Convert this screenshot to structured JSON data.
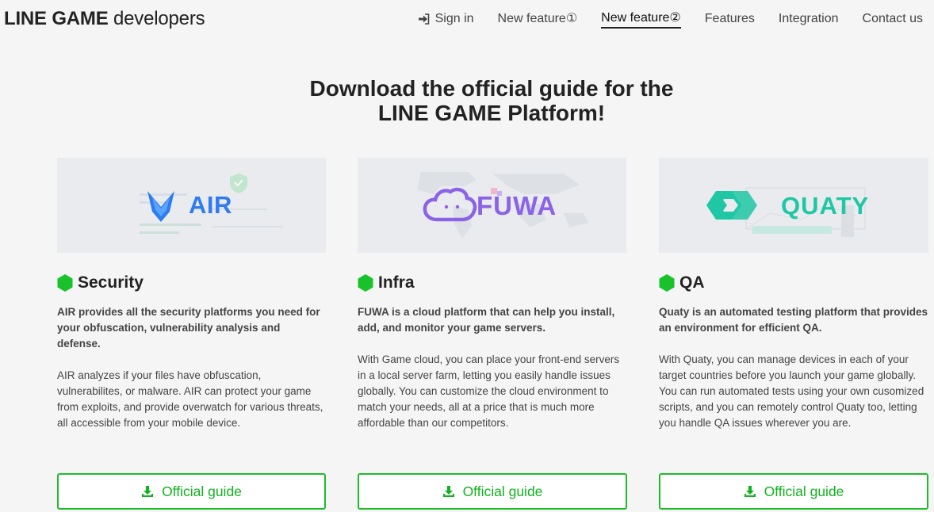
{
  "header": {
    "brand_bold": "LINE GAME",
    "brand_rest": " developers",
    "nav": [
      {
        "label": "Sign in",
        "icon": "sign-in-icon"
      },
      {
        "label": "New feature①"
      },
      {
        "label": "New feature②",
        "active": true
      },
      {
        "label": "Features"
      },
      {
        "label": "Integration"
      },
      {
        "label": "Contact us"
      }
    ]
  },
  "hero": {
    "line1": "Download the official guide for the",
    "line2": "LINE GAME Platform!"
  },
  "columns": [
    {
      "logo_text": "AIR",
      "title": "Security",
      "lead": "AIR provides all the security platforms you need for your obfuscation, vulnerability analysis and defense.",
      "body": "AIR analyzes if your files have obfuscation, vulnerabilites, or malware. AIR can protect your game from exploits, and provide overwatch for various threats, all accessible from your mobile device.",
      "button": "Official guide"
    },
    {
      "logo_text": "FUWA",
      "title": "Infra",
      "lead": "FUWA is a cloud platform that can help you install, add, and monitor your game servers.",
      "body": "With Game cloud, you can place your front-end servers in a local server farm, letting you easily handle issues globally. You can customize the cloud environment to match your needs, all at a price that is much more affordable than our competitors.",
      "button": "Official guide"
    },
    {
      "logo_text": "QUATY",
      "title": "QA",
      "lead": "Quaty is an automated testing platform that provides an environment for efficient QA.",
      "body": "With Quaty, you can manage devices in each of your target countries before you launch your game globally. You can run automated tests using your own cusomized scripts, and you can remotely control Quaty too, letting you handle QA issues wherever you are.",
      "button": "Official guide"
    }
  ],
  "colors": {
    "accent_green": "#10b21f",
    "air_blue": "#2f7cf0",
    "fuwa_purple": "#8b63e6",
    "quaty_teal": "#1fc7a5"
  }
}
